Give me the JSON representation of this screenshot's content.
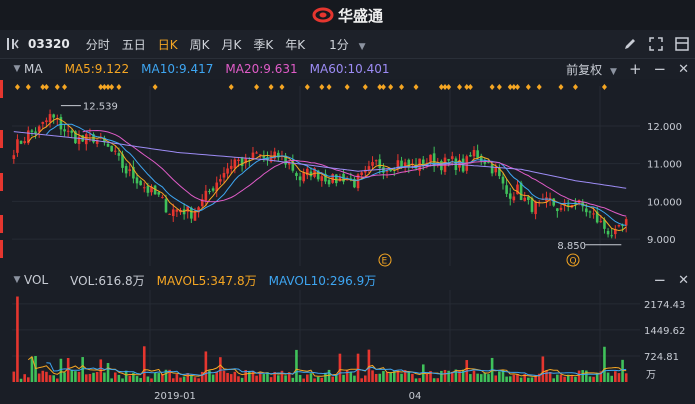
{
  "brand": {
    "name": "华盛通"
  },
  "toolbar": {
    "code": "03320",
    "periods": [
      {
        "label": "分时",
        "active": false
      },
      {
        "label": "五日",
        "active": false
      },
      {
        "label": "日K",
        "active": true
      },
      {
        "label": "周K",
        "active": false
      },
      {
        "label": "月K",
        "active": false
      },
      {
        "label": "季K",
        "active": false
      },
      {
        "label": "年K",
        "active": false
      }
    ],
    "minute_select": "1分",
    "icons": [
      "pencil-icon",
      "fullscreen-icon",
      "layout-icon"
    ]
  },
  "price_panel": {
    "label": "MA",
    "ma": [
      {
        "text": "MA5:9.122",
        "color": "#f5a623"
      },
      {
        "text": "MA10:9.417",
        "color": "#3ea6f2"
      },
      {
        "text": "MA20:9.631",
        "color": "#e05cc8"
      },
      {
        "text": "MA60:10.401",
        "color": "#9d8cf5"
      }
    ],
    "adjust_label": "前复权",
    "high_label": "12.539",
    "low_label": "8.850",
    "event_markers": [
      "E",
      "Q"
    ]
  },
  "volume_panel": {
    "label": "VOL",
    "vol": [
      {
        "text": "VOL:616.8万",
        "color": "#c8ccd4"
      },
      {
        "text": "MAVOL5:347.8万",
        "color": "#f5a623"
      },
      {
        "text": "MAVOL10:296.9万",
        "color": "#3ea6f2"
      }
    ],
    "unit_label": "万"
  },
  "x_labels": [
    "2019-01",
    "04"
  ],
  "colors": {
    "up": "#e5362f",
    "down": "#3fc15a",
    "grid": "#262b34",
    "bg": "#1a1e26",
    "marker": "#f5a623"
  },
  "chart_data": {
    "type": "candlestick",
    "price_axis": {
      "ticks": [
        9.0,
        10.0,
        11.0,
        12.0
      ],
      "range": [
        8.5,
        12.9
      ]
    },
    "volume_axis": {
      "ticks": [
        "724.81",
        "1449.62",
        "2174.43"
      ],
      "max": 2450
    },
    "high": 12.539,
    "low": 8.85,
    "anchors": [
      [
        0,
        11.4
      ],
      [
        4,
        11.8
      ],
      [
        7,
        11.9
      ],
      [
        10,
        12.25
      ],
      [
        12,
        12.1
      ],
      [
        15,
        11.8
      ],
      [
        19,
        11.6
      ],
      [
        22,
        11.7
      ],
      [
        25,
        11.5
      ],
      [
        28,
        11.2
      ],
      [
        31,
        10.8
      ],
      [
        34,
        10.6
      ],
      [
        37,
        10.3
      ],
      [
        40,
        10.1
      ],
      [
        43,
        9.75
      ],
      [
        46,
        9.8
      ],
      [
        49,
        9.7
      ],
      [
        52,
        10.0
      ],
      [
        55,
        10.4
      ],
      [
        58,
        10.8
      ],
      [
        61,
        11.1
      ],
      [
        64,
        11.0
      ],
      [
        67,
        11.25
      ],
      [
        70,
        11.1
      ],
      [
        73,
        11.2
      ],
      [
        76,
        11.0
      ],
      [
        79,
        10.6
      ],
      [
        82,
        10.8
      ],
      [
        85,
        10.7
      ],
      [
        88,
        10.55
      ],
      [
        91,
        10.65
      ],
      [
        94,
        10.5
      ],
      [
        97,
        10.7
      ],
      [
        100,
        11.0
      ],
      [
        103,
        10.9
      ],
      [
        106,
        11.05
      ],
      [
        109,
        10.9
      ],
      [
        112,
        11.0
      ],
      [
        115,
        11.1
      ],
      [
        118,
        11.0
      ],
      [
        121,
        11.05
      ],
      [
        124,
        10.9
      ],
      [
        127,
        11.3
      ],
      [
        130,
        11.1
      ],
      [
        133,
        10.8
      ],
      [
        136,
        10.2
      ],
      [
        139,
        10.3
      ],
      [
        142,
        9.9
      ],
      [
        145,
        9.85
      ],
      [
        148,
        10.0
      ],
      [
        151,
        9.75
      ],
      [
        154,
        10.0
      ],
      [
        157,
        9.85
      ],
      [
        160,
        9.6
      ],
      [
        163,
        9.3
      ],
      [
        166,
        9.1
      ],
      [
        169,
        9.4
      ]
    ],
    "ma60": [
      [
        0,
        11.85
      ],
      [
        20,
        11.65
      ],
      [
        45,
        11.3
      ],
      [
        70,
        11.1
      ],
      [
        95,
        10.8
      ],
      [
        120,
        11.0
      ],
      [
        140,
        10.85
      ],
      [
        155,
        10.55
      ],
      [
        169,
        10.35
      ]
    ]
  }
}
